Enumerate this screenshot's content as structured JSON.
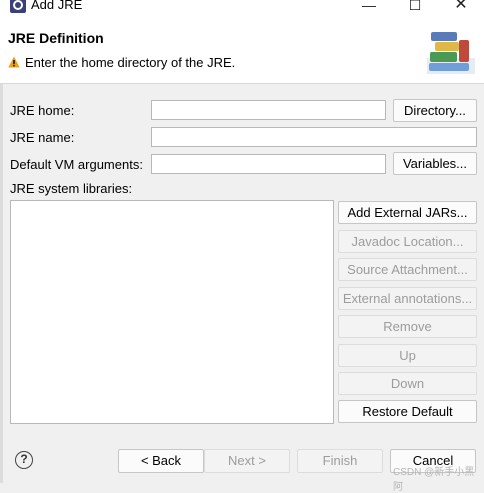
{
  "window": {
    "title": "Add JRE"
  },
  "header": {
    "title": "JRE Definition",
    "message": "Enter the home directory of the JRE."
  },
  "form": {
    "jre_home_label": "JRE home:",
    "jre_home_value": "",
    "directory_button": "Directory...",
    "jre_name_label": "JRE name:",
    "jre_name_value": "",
    "vm_args_label": "Default VM arguments:",
    "vm_args_value": "",
    "variables_button": "Variables...",
    "libraries_label": "JRE system libraries:"
  },
  "library_buttons": {
    "add_external_jars": "Add External JARs...",
    "javadoc_location": "Javadoc Location...",
    "source_attachment": "Source Attachment...",
    "external_annotations": "External annotations...",
    "remove": "Remove",
    "up": "Up",
    "down": "Down",
    "restore_default": "Restore Default"
  },
  "footer": {
    "help": "?",
    "back": "< Back",
    "next": "Next >",
    "finish": "Finish",
    "cancel": "Cancel",
    "watermark": "CSDN @新手小黑阿"
  },
  "colors": {
    "warning": "#e8a317",
    "dialog_bg": "#f0f0f0"
  }
}
